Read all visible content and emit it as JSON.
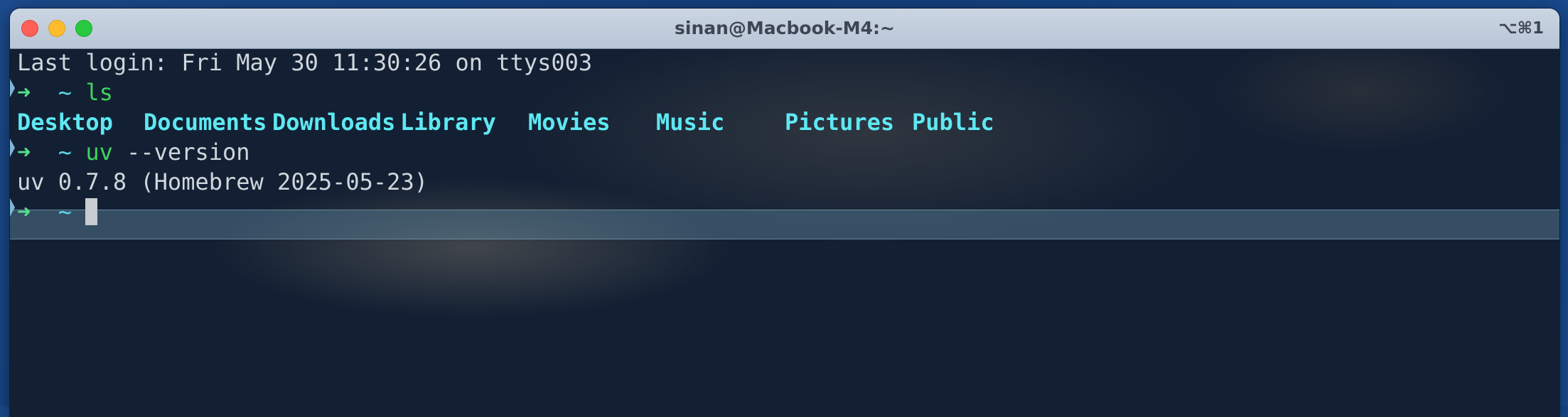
{
  "window": {
    "title": "sinan@Macbook-M4:~",
    "shortcut": "⌥⌘1"
  },
  "terminal": {
    "last_login": "Last login: Fri May 30 11:30:26 on ttys003",
    "prompt_arrow": "➜",
    "prompt_dir": "~",
    "cmd1": "ls",
    "ls_output": [
      "Desktop",
      "Documents",
      "Downloads",
      "Library",
      "Movies",
      "Music",
      "Pictures",
      "Public"
    ],
    "cmd2_program": "uv",
    "cmd2_args": " --version",
    "uv_output": "uv 0.7.8 (Homebrew 2025-05-23)"
  },
  "colors": {
    "prompt_arrow": "#56e08a",
    "command": "#3fd35c",
    "directory": "#5ee8f2",
    "background": "#132033"
  }
}
